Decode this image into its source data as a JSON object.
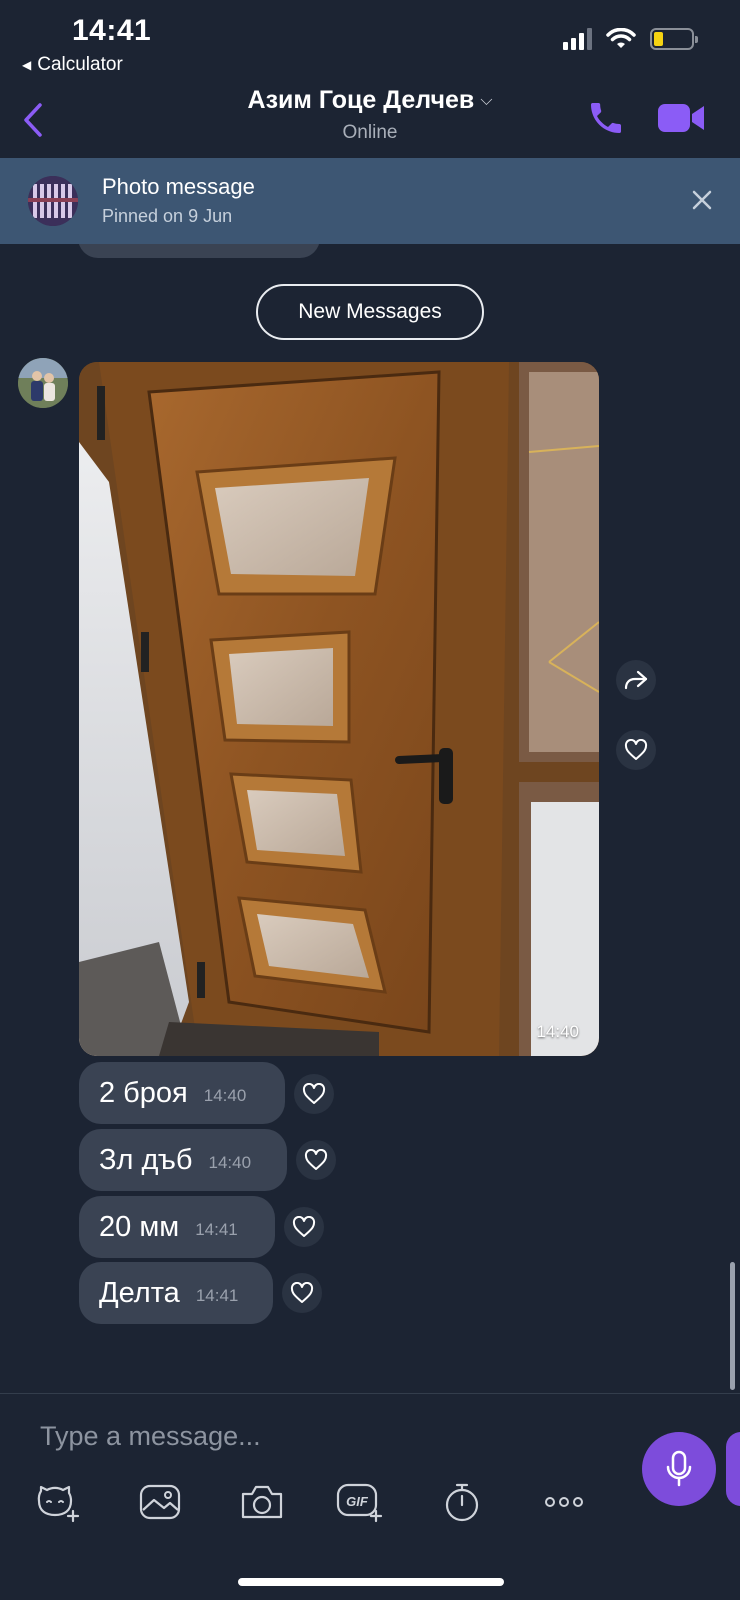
{
  "status_bar": {
    "time": "14:41",
    "back_app": "Calculator",
    "battery_color": "#f5d312"
  },
  "header": {
    "contact_name": "Азим Гоце Делчев",
    "contact_status": "Online",
    "accent_color": "#7d4cdb"
  },
  "pinned": {
    "title": "Photo message",
    "subtitle": "Pinned on 9 Jun"
  },
  "new_messages_label": "New Messages",
  "photo_message": {
    "time": "14:40"
  },
  "messages": [
    {
      "text": "2 броя",
      "time": "14:40"
    },
    {
      "text": "Зл дъб",
      "time": "14:40"
    },
    {
      "text": "20 мм",
      "time": "14:41"
    },
    {
      "text": "Делта",
      "time": "14:41"
    }
  ],
  "composer": {
    "placeholder": "Type a message..."
  },
  "toolbar": [
    "sticker-icon",
    "gallery-icon",
    "camera-icon",
    "gif-icon",
    "timer-icon",
    "more-icon"
  ]
}
